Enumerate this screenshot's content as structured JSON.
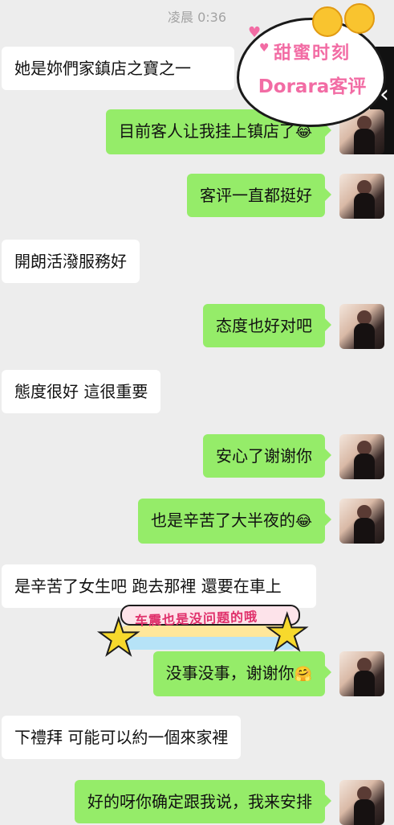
{
  "header": {
    "timestamp": "凌晨 0:36"
  },
  "sticker_top": {
    "line1": "甜蜜时刻",
    "line2": "Dorara客评"
  },
  "messages": [
    {
      "side": "left",
      "text": "她是妳們家鎮店之寶之一"
    },
    {
      "side": "right",
      "text": "目前客人让我挂上镇店了",
      "emoji": "😂"
    },
    {
      "side": "right",
      "text": "客评一直都挺好"
    },
    {
      "side": "left",
      "text": "開朗活潑服務好"
    },
    {
      "side": "right",
      "text": "态度也好对吧"
    },
    {
      "side": "left",
      "text": "態度很好 這很重要"
    },
    {
      "side": "right",
      "text": "安心了谢谢你"
    },
    {
      "side": "right",
      "text": "也是辛苦了大半夜的",
      "emoji": "😂"
    },
    {
      "side": "left",
      "text": "是辛苦了女生吧 跑去那裡 還要在車上"
    },
    {
      "side": "right",
      "text": "没事没事，谢谢你",
      "emoji": "🤗"
    },
    {
      "side": "left",
      "text": "下禮拜 可能可以約一個來家裡"
    },
    {
      "side": "right",
      "text": "好的呀你确定跟我说，我来安排"
    }
  ],
  "sticker_rainbow": {
    "caption": "车震也是没问题的哦"
  },
  "colors": {
    "background": "#ededed",
    "bubble_self": "#95ec69",
    "bubble_other": "#ffffff",
    "sticker_pink": "#f26ca4"
  },
  "icons": {
    "side_panel": "chevron-left-icon"
  }
}
